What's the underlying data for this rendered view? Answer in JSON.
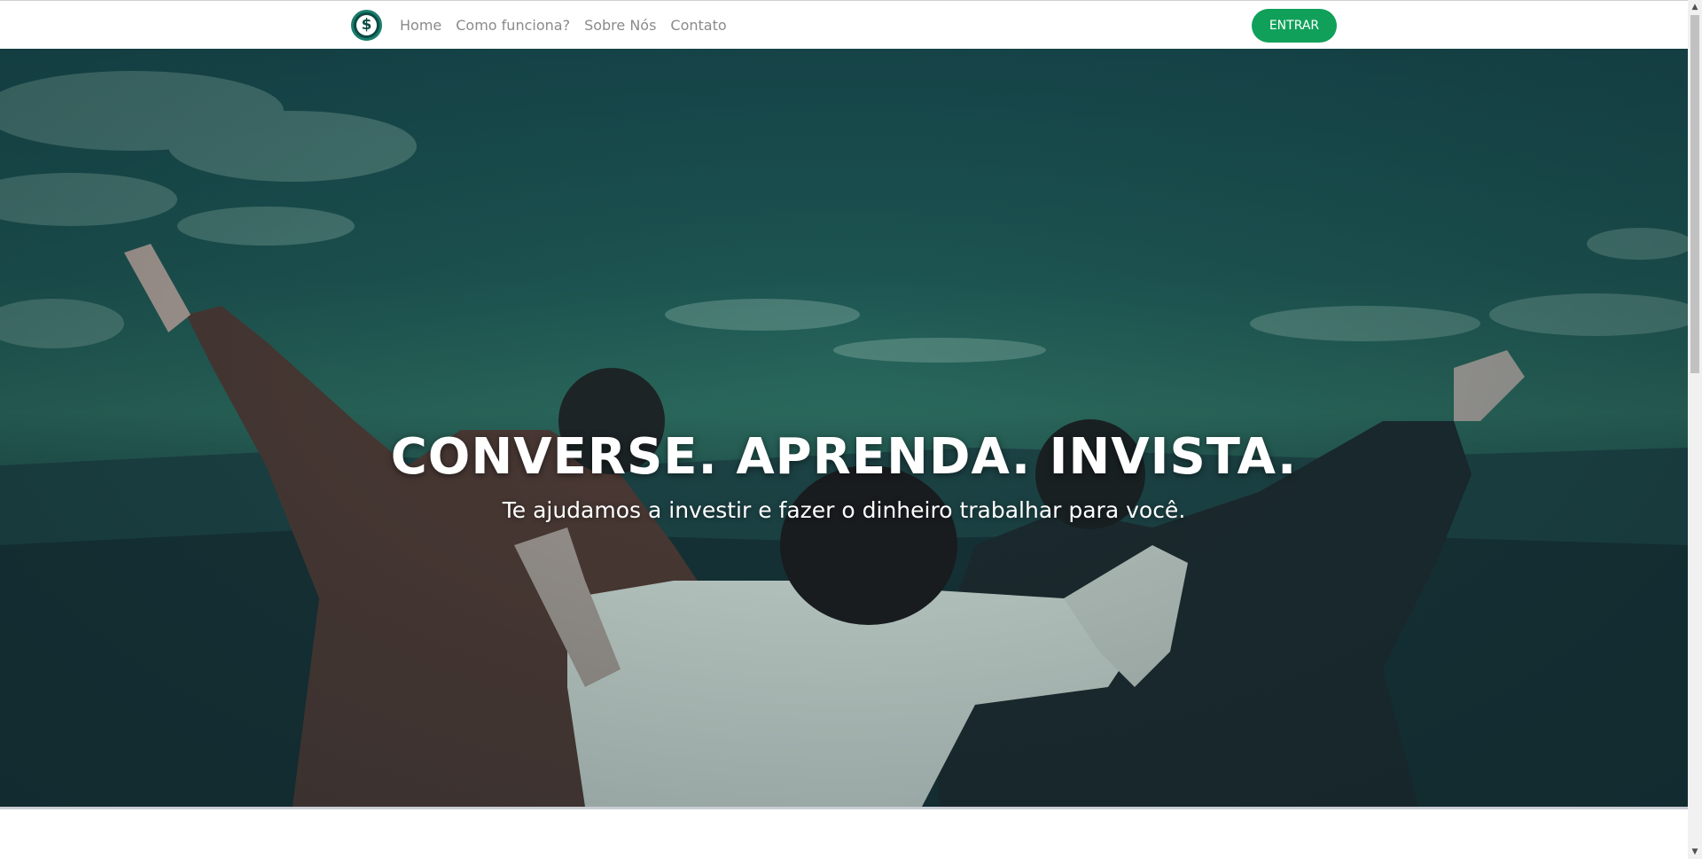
{
  "nav": {
    "logo_glyph": "$",
    "links": [
      "Home",
      "Como funciona?",
      "Sobre Nós",
      "Contato"
    ],
    "login_button": "ENTRAR"
  },
  "hero": {
    "title": "CONVERSE. APRENDA. INVISTA.",
    "subtitle": "Te ajudamos a investir e fazer o dinheiro trabalhar para você."
  },
  "scrollbar": {
    "up_arrow": "▲",
    "down_arrow": "▼"
  },
  "colors": {
    "accent": "#10a05a",
    "logo": "#0d4a44",
    "hero_tint": "#1d5653"
  }
}
